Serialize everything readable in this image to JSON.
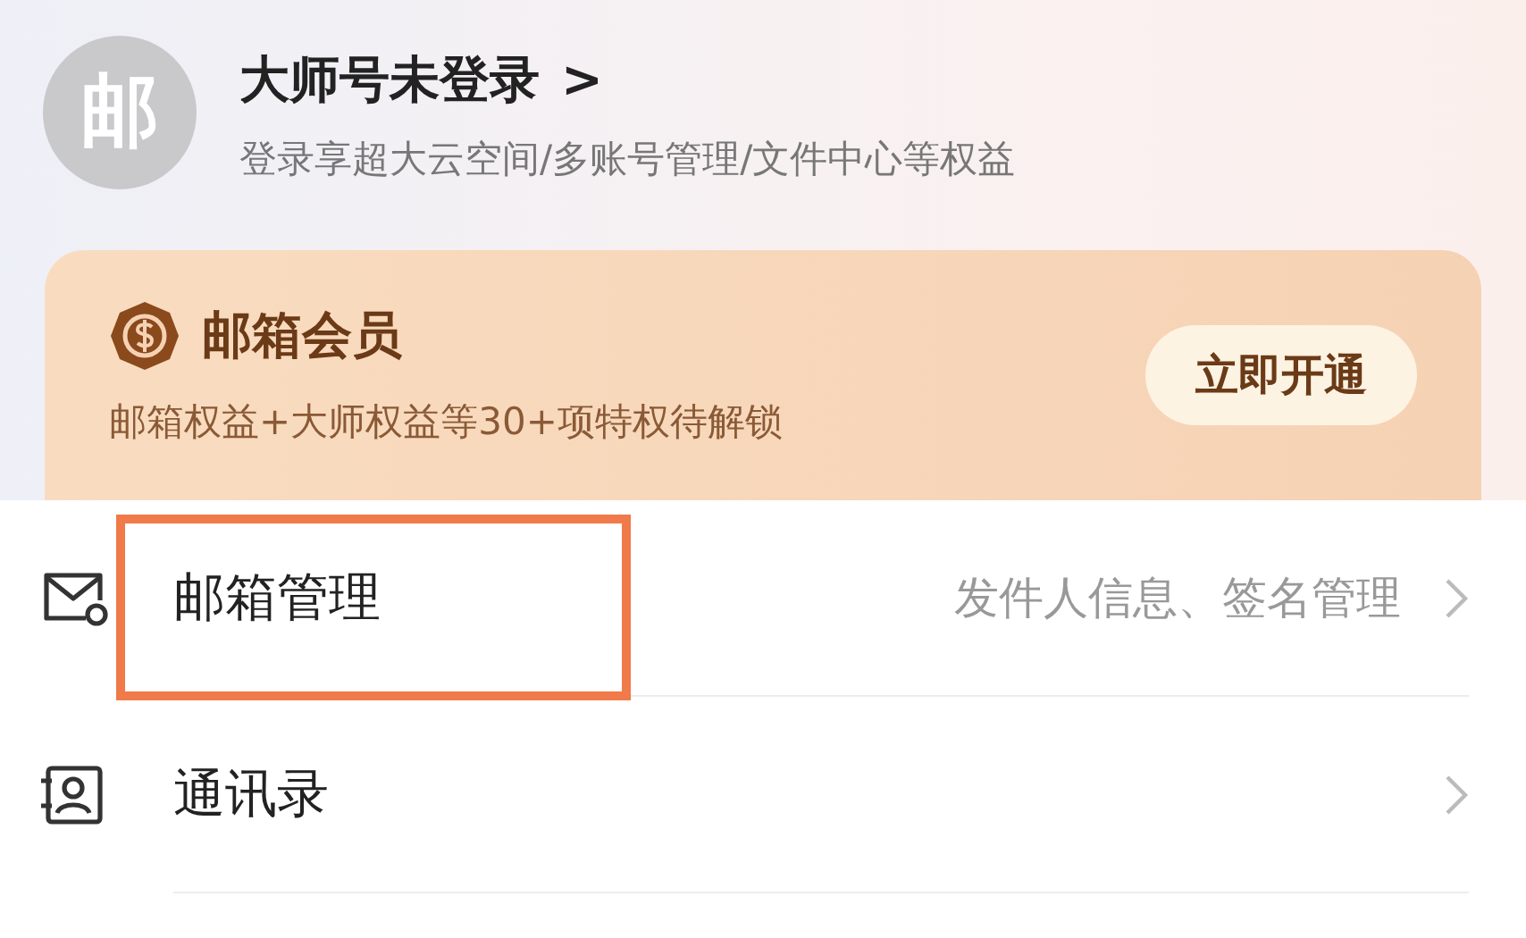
{
  "profile": {
    "avatar_glyph": "邮",
    "title": "大师号未登录",
    "title_arrow": ">",
    "subtitle": "登录享超大云空间/多账号管理/文件中心等权益"
  },
  "membership": {
    "title": "邮箱会员",
    "subtitle": "邮箱权益+大师权益等30+项特权待解锁",
    "button": "立即开通"
  },
  "menu": [
    {
      "kind": "mail",
      "label": "邮箱管理",
      "detail": "发件人信息、签名管理",
      "highlighted": true
    },
    {
      "kind": "contacts",
      "label": "通讯录",
      "highlighted": false
    }
  ]
}
